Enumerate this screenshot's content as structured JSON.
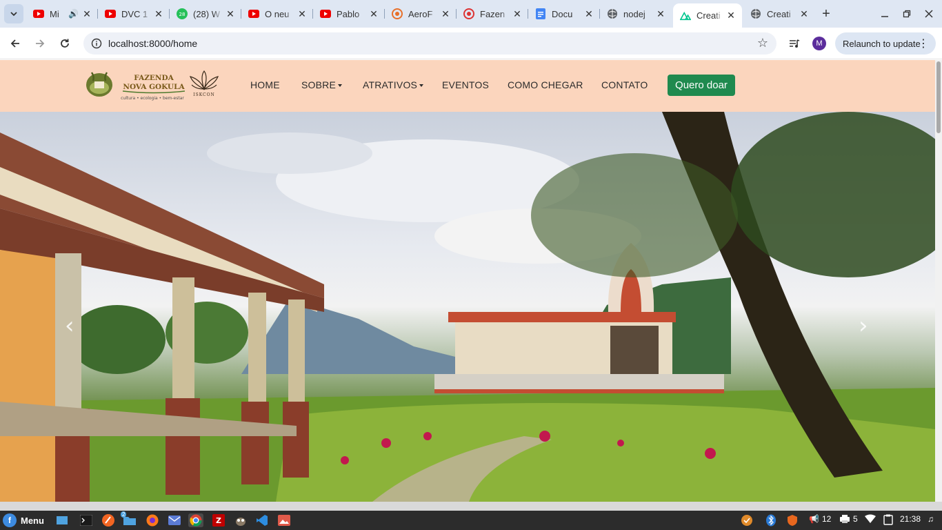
{
  "browser": {
    "tabs": [
      {
        "title": "Mi",
        "favicon": "youtube-icon",
        "audio": true,
        "active": false
      },
      {
        "title": "DVC 1",
        "favicon": "youtube-icon",
        "active": false
      },
      {
        "title": "(28) W",
        "favicon": "whatsapp-icon",
        "badge": "28",
        "active": false
      },
      {
        "title": "O neu",
        "favicon": "youtube-icon",
        "active": false
      },
      {
        "title": "Pablo",
        "favicon": "youtube-icon",
        "active": false
      },
      {
        "title": "AeroF",
        "favicon": "target-icon",
        "active": false
      },
      {
        "title": "Fazen",
        "favicon": "red-circle-icon",
        "active": false
      },
      {
        "title": "Docu",
        "favicon": "docs-icon",
        "active": false
      },
      {
        "title": "nodej",
        "favicon": "globe-icon",
        "active": false
      },
      {
        "title": "Creati",
        "favicon": "nuxt-icon",
        "active": true
      },
      {
        "title": "Creati",
        "favicon": "globe-icon",
        "active": false
      }
    ],
    "url": "localhost:8000/home",
    "avatar_letter": "M",
    "relaunch_label": "Relaunch to update"
  },
  "site": {
    "logo": {
      "name_line1": "FAZENDA",
      "name_line2": "NOVA GOKULA",
      "tagline": "cultura • ecologia • bem-estar",
      "partner": "ISKCON"
    },
    "nav": [
      {
        "label": "HOME",
        "dropdown": false
      },
      {
        "label": "SOBRE",
        "dropdown": true
      },
      {
        "label": "ATRATIVOS",
        "dropdown": true
      },
      {
        "label": "EVENTOS",
        "dropdown": false
      },
      {
        "label": "COMO CHEGAR",
        "dropdown": false
      },
      {
        "label": "CONTATO",
        "dropdown": false
      }
    ],
    "donate_label": "Quero doar",
    "colors": {
      "navbar_bg": "#fbd5bd",
      "donate_bg": "#1f8a4f"
    },
    "carousel": {
      "prev": "‹",
      "next": "›"
    }
  },
  "taskbar": {
    "menu_label": "Menu",
    "badge_files": "2",
    "tray_notifications": "12",
    "tray_printers": "5",
    "clock": "21:38"
  }
}
